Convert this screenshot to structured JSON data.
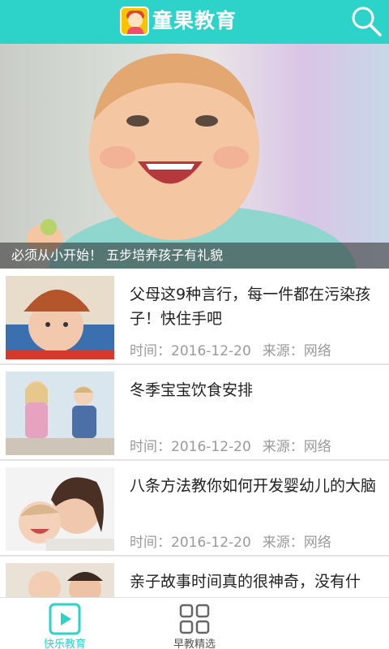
{
  "header": {
    "app_title": "童果教育",
    "logo_icon": "app-logo-icon",
    "search_icon": "search-icon",
    "bar_color": "#2dd2c8"
  },
  "banner": {
    "caption": "必须从小开始！ 五步培养孩子有礼貌"
  },
  "articles": [
    {
      "title": "父母这9种言行，每一件都在污染孩子！快住手吧",
      "time": "时间：2016-12-20",
      "source": "来源：网络"
    },
    {
      "title": "冬季宝宝饮食安排",
      "time": "时间：2016-12-20",
      "source": "来源：网络"
    },
    {
      "title": "八条方法教你如何开发婴幼儿的大脑",
      "time": "时间：2016-12-20",
      "source": "来源：网络"
    },
    {
      "title": "亲子故事时间真的很神奇，没有什",
      "time": "",
      "source": ""
    }
  ],
  "bottom_nav": {
    "tabs": [
      {
        "label": "快乐教育",
        "icon": "play-icon",
        "active": true
      },
      {
        "label": "早教精选",
        "icon": "grid-icon",
        "active": false
      }
    ],
    "active_color": "#2dd2c8"
  }
}
